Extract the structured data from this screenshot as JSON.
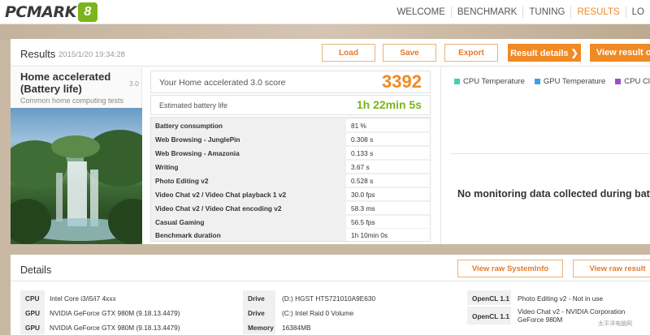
{
  "app": {
    "logo_text": "PCMARK",
    "logo_badge": "8"
  },
  "nav": {
    "items": [
      {
        "label": "WELCOME"
      },
      {
        "label": "BENCHMARK"
      },
      {
        "label": "TUNING"
      },
      {
        "label": "RESULTS",
        "active": true
      },
      {
        "label": "LO"
      }
    ]
  },
  "results": {
    "title": "Results",
    "date": "2015/1/20 19:34:28",
    "buttons": {
      "load": "Load",
      "save": "Save",
      "export": "Export",
      "details": "Result details ❯",
      "view_online": "View result on"
    }
  },
  "test": {
    "name": "Home accelerated (Battery life)",
    "version": "3.0",
    "description": "Common home computing tests"
  },
  "score": {
    "label": "Your Home accelerated 3.0 score",
    "value": "3392",
    "battery_label": "Estimated battery life",
    "battery_value": "1h 22min 5s"
  },
  "metrics": [
    {
      "name": "Battery consumption",
      "value": "81 %"
    },
    {
      "name": "Web Browsing - JunglePin",
      "value": "0.308 s"
    },
    {
      "name": "Web Browsing - Amazonia",
      "value": "0.133 s"
    },
    {
      "name": "Writing",
      "value": "3.67 s"
    },
    {
      "name": "Photo Editing v2",
      "value": "0.528 s"
    },
    {
      "name": "Video Chat v2 / Video Chat playback 1 v2",
      "value": "30.0 fps"
    },
    {
      "name": "Video Chat v2 / Video Chat encoding v2",
      "value": "58.3 ms"
    },
    {
      "name": "Casual Gaming",
      "value": "56.5 fps"
    },
    {
      "name": "Benchmark duration",
      "value": "1h 10min 0s"
    }
  ],
  "monitoring": {
    "legend": [
      {
        "label": "CPU Temperature",
        "color": "#3fd1b1"
      },
      {
        "label": "GPU Temperature",
        "color": "#3aa3e3"
      },
      {
        "label": "CPU Clock",
        "color": "#9a4ed0"
      }
    ],
    "message": "No monitoring data collected during battery te"
  },
  "details": {
    "title": "Details",
    "btn_raw_sysinfo": "View raw SystemInfo",
    "btn_raw_result": "View raw result",
    "col1": [
      {
        "label": "CPU",
        "value": "Intel Core i3/i5/i7 4xxx"
      },
      {
        "label": "GPU",
        "value": "NVIDIA GeForce GTX 980M (9.18.13.4479)"
      },
      {
        "label": "GPU",
        "value": "NVIDIA GeForce GTX 980M (9.18.13.4479)"
      }
    ],
    "col2": [
      {
        "label": "Drive",
        "value": "(D:) HGST HTS721010A9E630"
      },
      {
        "label": "Drive",
        "value": "(C:) Intel Raid 0 Volume"
      },
      {
        "label": "Memory",
        "value": "16384MB"
      }
    ],
    "col3": [
      {
        "label": "OpenCL 1.1",
        "value": "Photo Editing v2 - Not in use"
      },
      {
        "label": "OpenCL 1.1",
        "value": "Video Chat v2 - NVIDIA Corporation GeForce 980M"
      }
    ]
  },
  "watermark": "太平洋电脑网"
}
